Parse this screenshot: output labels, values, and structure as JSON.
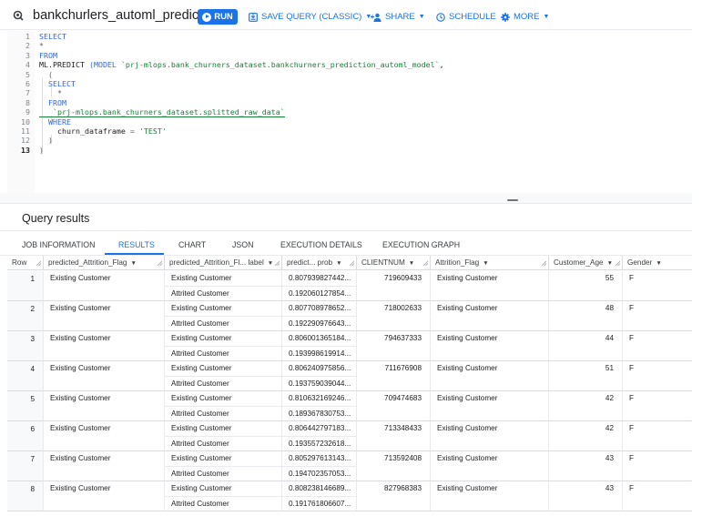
{
  "toolbar": {
    "query_icon": "query-icon",
    "title": "bankchurlers_automl_predict",
    "run_label": "RUN",
    "save_label": "SAVE QUERY (CLASSIC)",
    "share_label": "SHARE",
    "schedule_label": "SCHEDULE",
    "more_label": "MORE",
    "accent_color": "#1a73e8"
  },
  "editor": {
    "line_numbers": [
      "1",
      "2",
      "3",
      "4",
      "5",
      "6",
      "7",
      "8",
      "9",
      "10",
      "11",
      "12",
      "13"
    ],
    "lines": [
      {
        "parts": [
          {
            "t": "SELECT",
            "c": "kw"
          }
        ]
      },
      {
        "parts": [
          {
            "t": "*",
            "c": "punct"
          }
        ]
      },
      {
        "parts": [
          {
            "t": "FROM",
            "c": "kw"
          }
        ]
      },
      {
        "parts": [
          {
            "t": "ML.PREDICT ",
            "c": ""
          },
          {
            "t": "(MODEL ",
            "c": "kw"
          },
          {
            "t": "`prj-mlops.bank_churners_dataset.bankchurners_prediction_automl_model`",
            "c": "str"
          },
          {
            "t": ",",
            "c": ""
          }
        ]
      },
      {
        "parts": [
          {
            "t": "  (",
            "c": "punct"
          }
        ]
      },
      {
        "parts": [
          {
            "t": "  SELECT",
            "c": "kw"
          }
        ]
      },
      {
        "parts": [
          {
            "t": "    *",
            "c": "punct"
          }
        ]
      },
      {
        "parts": [
          {
            "t": "  FROM",
            "c": "kw"
          }
        ]
      },
      {
        "parts": [
          {
            "t": "   `prj-mlops.bank_churners_dataset.splitted_raw_data`",
            "c": "str"
          }
        ]
      },
      {
        "parts": [
          {
            "t": "  WHERE",
            "c": "kw"
          }
        ]
      },
      {
        "parts": [
          {
            "t": "    churn_dataframe ",
            "c": ""
          },
          {
            "t": "= ",
            "c": "punct"
          },
          {
            "t": "'TEST'",
            "c": "str"
          }
        ]
      },
      {
        "parts": [
          {
            "t": "  )",
            "c": "punct"
          }
        ]
      },
      {
        "parts": [
          {
            "t": ")",
            "c": "punct"
          }
        ]
      }
    ]
  },
  "results": {
    "title": "Query results",
    "tabs": [
      {
        "label": "JOB INFORMATION",
        "active": false
      },
      {
        "label": "RESULTS",
        "active": true
      },
      {
        "label": "CHART",
        "active": false
      },
      {
        "label": "JSON",
        "active": false
      },
      {
        "label": "EXECUTION DETAILS",
        "active": false
      },
      {
        "label": "EXECUTION GRAPH",
        "active": false
      }
    ],
    "columns": [
      "Row",
      "predicted_Attrition_Flag",
      "predicted_Attrition_Fl... label",
      "predict... prob",
      "CLIENTNUM",
      "Attrition_Flag",
      "Customer_Age",
      "Gender"
    ],
    "rows": [
      {
        "row": "1",
        "predicted": "Existing Customer",
        "labels": [
          "Existing Customer",
          "Attrited Customer"
        ],
        "probs": [
          "0.807939827442...",
          "0.192060127854..."
        ],
        "clientnum": "719609433",
        "attrition": "Existing Customer",
        "age": "55",
        "gender": "F"
      },
      {
        "row": "2",
        "predicted": "Existing Customer",
        "labels": [
          "Existing Customer",
          "Attrited Customer"
        ],
        "probs": [
          "0.807708978652...",
          "0.192290976643..."
        ],
        "clientnum": "718002633",
        "attrition": "Existing Customer",
        "age": "48",
        "gender": "F"
      },
      {
        "row": "3",
        "predicted": "Existing Customer",
        "labels": [
          "Existing Customer",
          "Attrited Customer"
        ],
        "probs": [
          "0.806001365184...",
          "0.193998619914..."
        ],
        "clientnum": "794637333",
        "attrition": "Existing Customer",
        "age": "44",
        "gender": "F"
      },
      {
        "row": "4",
        "predicted": "Existing Customer",
        "labels": [
          "Existing Customer",
          "Attrited Customer"
        ],
        "probs": [
          "0.806240975856...",
          "0.193759039044..."
        ],
        "clientnum": "711676908",
        "attrition": "Existing Customer",
        "age": "51",
        "gender": "F"
      },
      {
        "row": "5",
        "predicted": "Existing Customer",
        "labels": [
          "Existing Customer",
          "Attrited Customer"
        ],
        "probs": [
          "0.810632169246...",
          "0.189367830753..."
        ],
        "clientnum": "709474683",
        "attrition": "Existing Customer",
        "age": "42",
        "gender": "F"
      },
      {
        "row": "6",
        "predicted": "Existing Customer",
        "labels": [
          "Existing Customer",
          "Attrited Customer"
        ],
        "probs": [
          "0.806442797183...",
          "0.193557232618..."
        ],
        "clientnum": "713348433",
        "attrition": "Existing Customer",
        "age": "42",
        "gender": "F"
      },
      {
        "row": "7",
        "predicted": "Existing Customer",
        "labels": [
          "Existing Customer",
          "Attrited Customer"
        ],
        "probs": [
          "0.805297613143...",
          "0.194702357053..."
        ],
        "clientnum": "713592408",
        "attrition": "Existing Customer",
        "age": "43",
        "gender": "F"
      },
      {
        "row": "8",
        "predicted": "Existing Customer",
        "labels": [
          "Existing Customer",
          "Attrited Customer"
        ],
        "probs": [
          "0.808238146689...",
          "0.191761806607..."
        ],
        "clientnum": "827968383",
        "attrition": "Existing Customer",
        "age": "43",
        "gender": "F"
      }
    ]
  }
}
